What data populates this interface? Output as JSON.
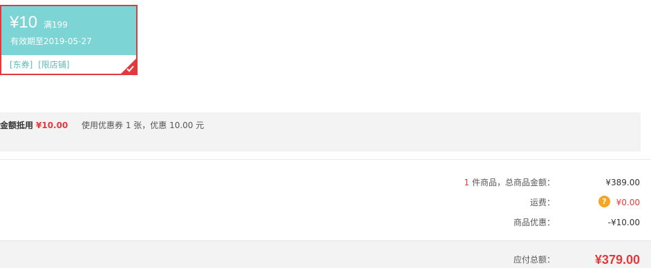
{
  "coupon": {
    "amount": "¥10",
    "condition": "满199",
    "expiry": "有效期至2019-05-27",
    "tag_jd": "[东券]",
    "tag_shop": "[限店铺]",
    "selected": true,
    "check_icon": "check-corner-icon"
  },
  "use_strip": {
    "label": "金额抵用",
    "amount": "¥10.00",
    "description": "使用优惠券 1 张，优惠 10.00 元"
  },
  "summary": {
    "item_count": "1",
    "goods_label": " 件商品，总商品金额：",
    "goods_value": "¥389.00",
    "freight_label": "运费：",
    "freight_help": "?",
    "freight_value": "¥0.00",
    "discount_label": "商品优惠：",
    "discount_value": "-¥10.00"
  },
  "total": {
    "label": "应付总额：",
    "value": "¥379.00"
  },
  "colors": {
    "coupon_bg": "#7dd4d4",
    "accent_red": "#e4393c",
    "help_orange": "#f5a623",
    "strip_bg": "#f3f3f3"
  }
}
